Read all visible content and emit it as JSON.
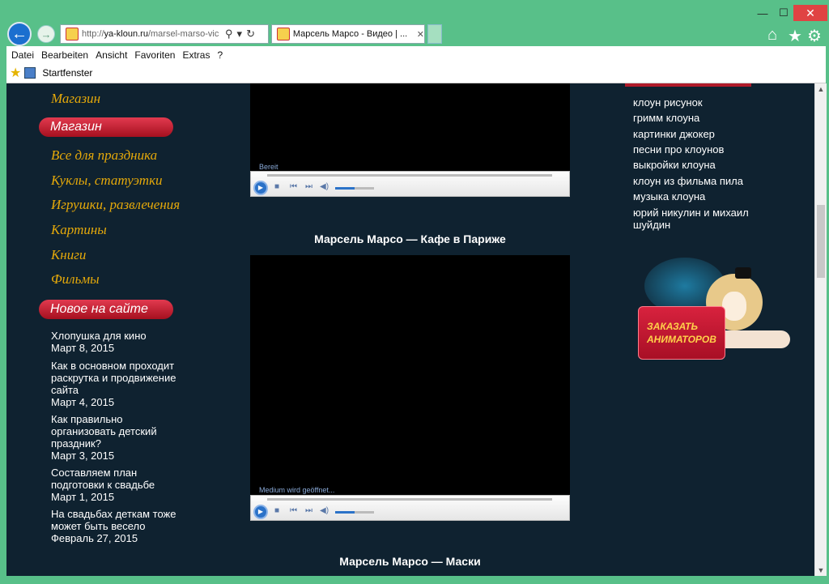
{
  "browser": {
    "window_controls": [
      "—",
      "☐",
      "✕"
    ],
    "back_label": "←",
    "forward_label": "→",
    "url_prefix": "http://",
    "url_domain": "ya-kloun.ru",
    "url_path": "/marsel-marso-vic",
    "tab_title": "Марсель Марсо - Видео | ...",
    "tab_close": "✕",
    "right_icons": [
      "⌂",
      "★",
      "⚙"
    ],
    "menu": [
      "Datei",
      "Bearbeiten",
      "Ansicht",
      "Favoriten",
      "Extras",
      "?"
    ],
    "favorites_bar": {
      "startpage_label": "Startfenster"
    }
  },
  "page": {
    "left_top_link": "Магазин",
    "shop_heading": "Магазин",
    "shop_links": [
      "Все для праздника",
      "Куклы, статуэтки",
      "Игрушки, развлечения",
      "Картины",
      "Книги",
      "Фильмы"
    ],
    "news_heading": "Новое на сайте",
    "posts": [
      {
        "title": "Хлопушка для кино",
        "date": "Март 8, 2015"
      },
      {
        "title": "Как в основном проходит раскрутка и продвижение сайта",
        "date": "Март 4, 2015"
      },
      {
        "title": "Как правильно организовать детский праздник?",
        "date": "Март 3, 2015"
      },
      {
        "title": "Составляем план подготовки к свадьбе",
        "date": "Март 1, 2015"
      },
      {
        "title": "На свадьбах деткам тоже может быть весело",
        "date": "Февраль 27, 2015"
      }
    ],
    "videos": [
      {
        "status": "Bereit",
        "title": "Марсель Марсо — Кафе в Париже"
      },
      {
        "status": "Medium wird geöffnet...",
        "title": "Марсель Марсо — Маски"
      }
    ],
    "right_links": [
      "клоун рисунок",
      "гримм клоуна",
      "картинки джокер",
      "песни про клоунов",
      "выкройки клоуна",
      "клоун из фильма пила",
      "музыка клоуна",
      "юрий никулин и михаил шуйдин"
    ],
    "promo": {
      "line1": "ЗАКАЗАТЬ",
      "line2": "АНИМАТОРОВ"
    }
  },
  "colors": {
    "frame": "#58c089",
    "page_bg": "#0f2230",
    "accent_gold": "#e5a90a",
    "pill_red": "#c41f34"
  }
}
